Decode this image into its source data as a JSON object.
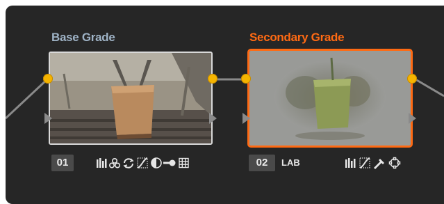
{
  "nodes": [
    {
      "title": "Base Grade",
      "number": "01",
      "title_color": "#9fb3c6",
      "selected": false,
      "tool_icons": [
        "rgb-mixer-icon",
        "color-wheels-icon",
        "refresh-icon",
        "curves-icon",
        "qualifier-icon",
        "key-icon",
        "grid-icon"
      ]
    },
    {
      "title": "Secondary Grade",
      "number": "02",
      "colorspace": "LAB",
      "title_color": "#ff6a13",
      "selected": true,
      "tool_icons": [
        "rgb-mixer-icon",
        "curves-icon",
        "eyedropper-icon",
        "window-icon"
      ]
    }
  ],
  "colors": {
    "background": "#262626",
    "wire": "#8a8a8a",
    "port": "#f5b400",
    "selection": "#ff6a13"
  }
}
